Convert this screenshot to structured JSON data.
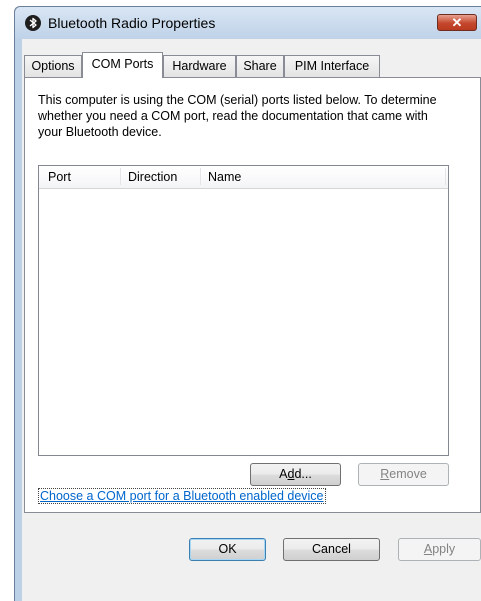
{
  "window": {
    "title": "Bluetooth Radio Properties",
    "close_symbol": "✕"
  },
  "tabs": [
    {
      "label": "Options",
      "active": false
    },
    {
      "label": "COM Ports",
      "active": true
    },
    {
      "label": "Hardware",
      "active": false
    },
    {
      "label": "Share",
      "active": false
    },
    {
      "label": "PIM Interface",
      "active": false
    }
  ],
  "description": "This computer is using the COM (serial) ports listed below. To determine whether you need a COM port, read the documentation that came with your Bluetooth device.",
  "list": {
    "columns": [
      "Port",
      "Direction",
      "Name"
    ],
    "rows": []
  },
  "buttons": {
    "add": {
      "label": "Add...",
      "mnemonic": "d"
    },
    "remove": {
      "label": "Remove",
      "mnemonic": "R"
    },
    "ok": "OK",
    "cancel": "Cancel",
    "apply": {
      "label": "Apply",
      "mnemonic": "A"
    }
  },
  "link": "Choose a COM port for a Bluetooth enabled device",
  "icons": {
    "title": "bluetooth-icon",
    "close": "close-icon"
  },
  "colors": {
    "link": "#0066cc",
    "close_button": "#c4472c",
    "frame": "#bcd0e6"
  }
}
